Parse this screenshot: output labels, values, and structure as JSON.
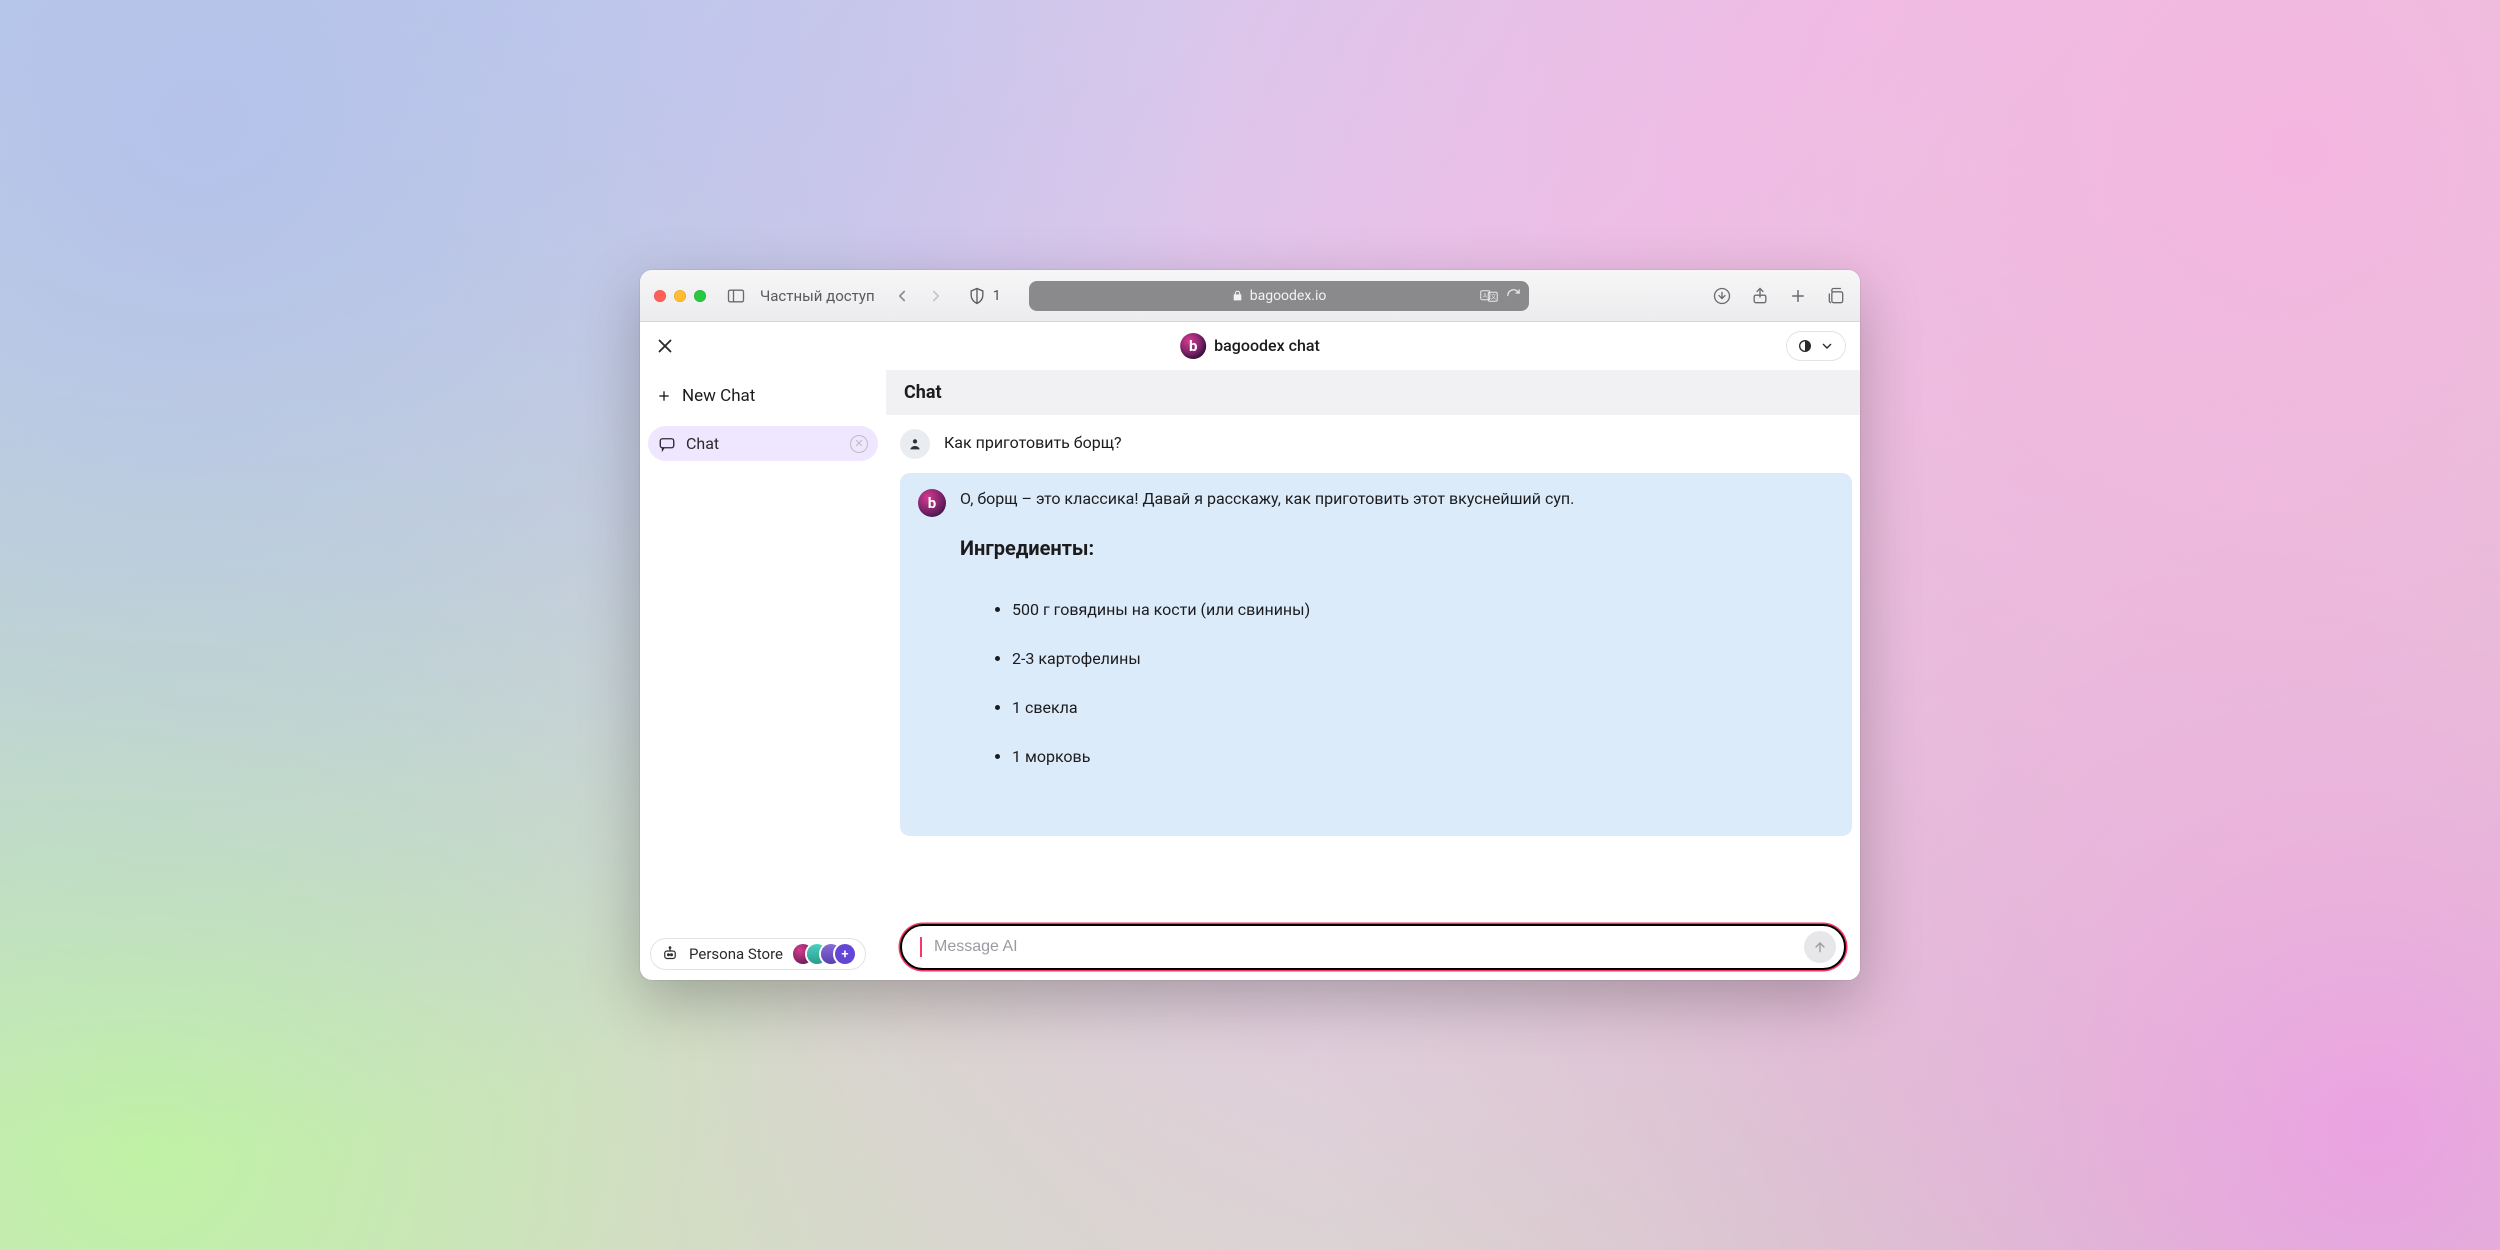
{
  "browser": {
    "private_label": "Частный доступ",
    "shield_count": "1",
    "url_host": "bagoodex.io"
  },
  "header": {
    "brand": "bagoodex chat"
  },
  "sidebar": {
    "new_chat_label": "New Chat",
    "items": [
      {
        "label": "Chat"
      }
    ],
    "persona_store_label": "Persona Store"
  },
  "chat": {
    "title": "Chat",
    "user_message": "Как приготовить борщ?",
    "ai": {
      "intro": "О, борщ – это классика! Давай я расскажу, как приготовить этот вкуснейший суп.",
      "ingredients_heading": "Ингредиенты:",
      "ingredients": [
        "500 г говядины на кости (или свинины)",
        "2-3 картофелины",
        "1 свекла",
        "1 морковь"
      ]
    },
    "input_placeholder": "Message AI"
  }
}
